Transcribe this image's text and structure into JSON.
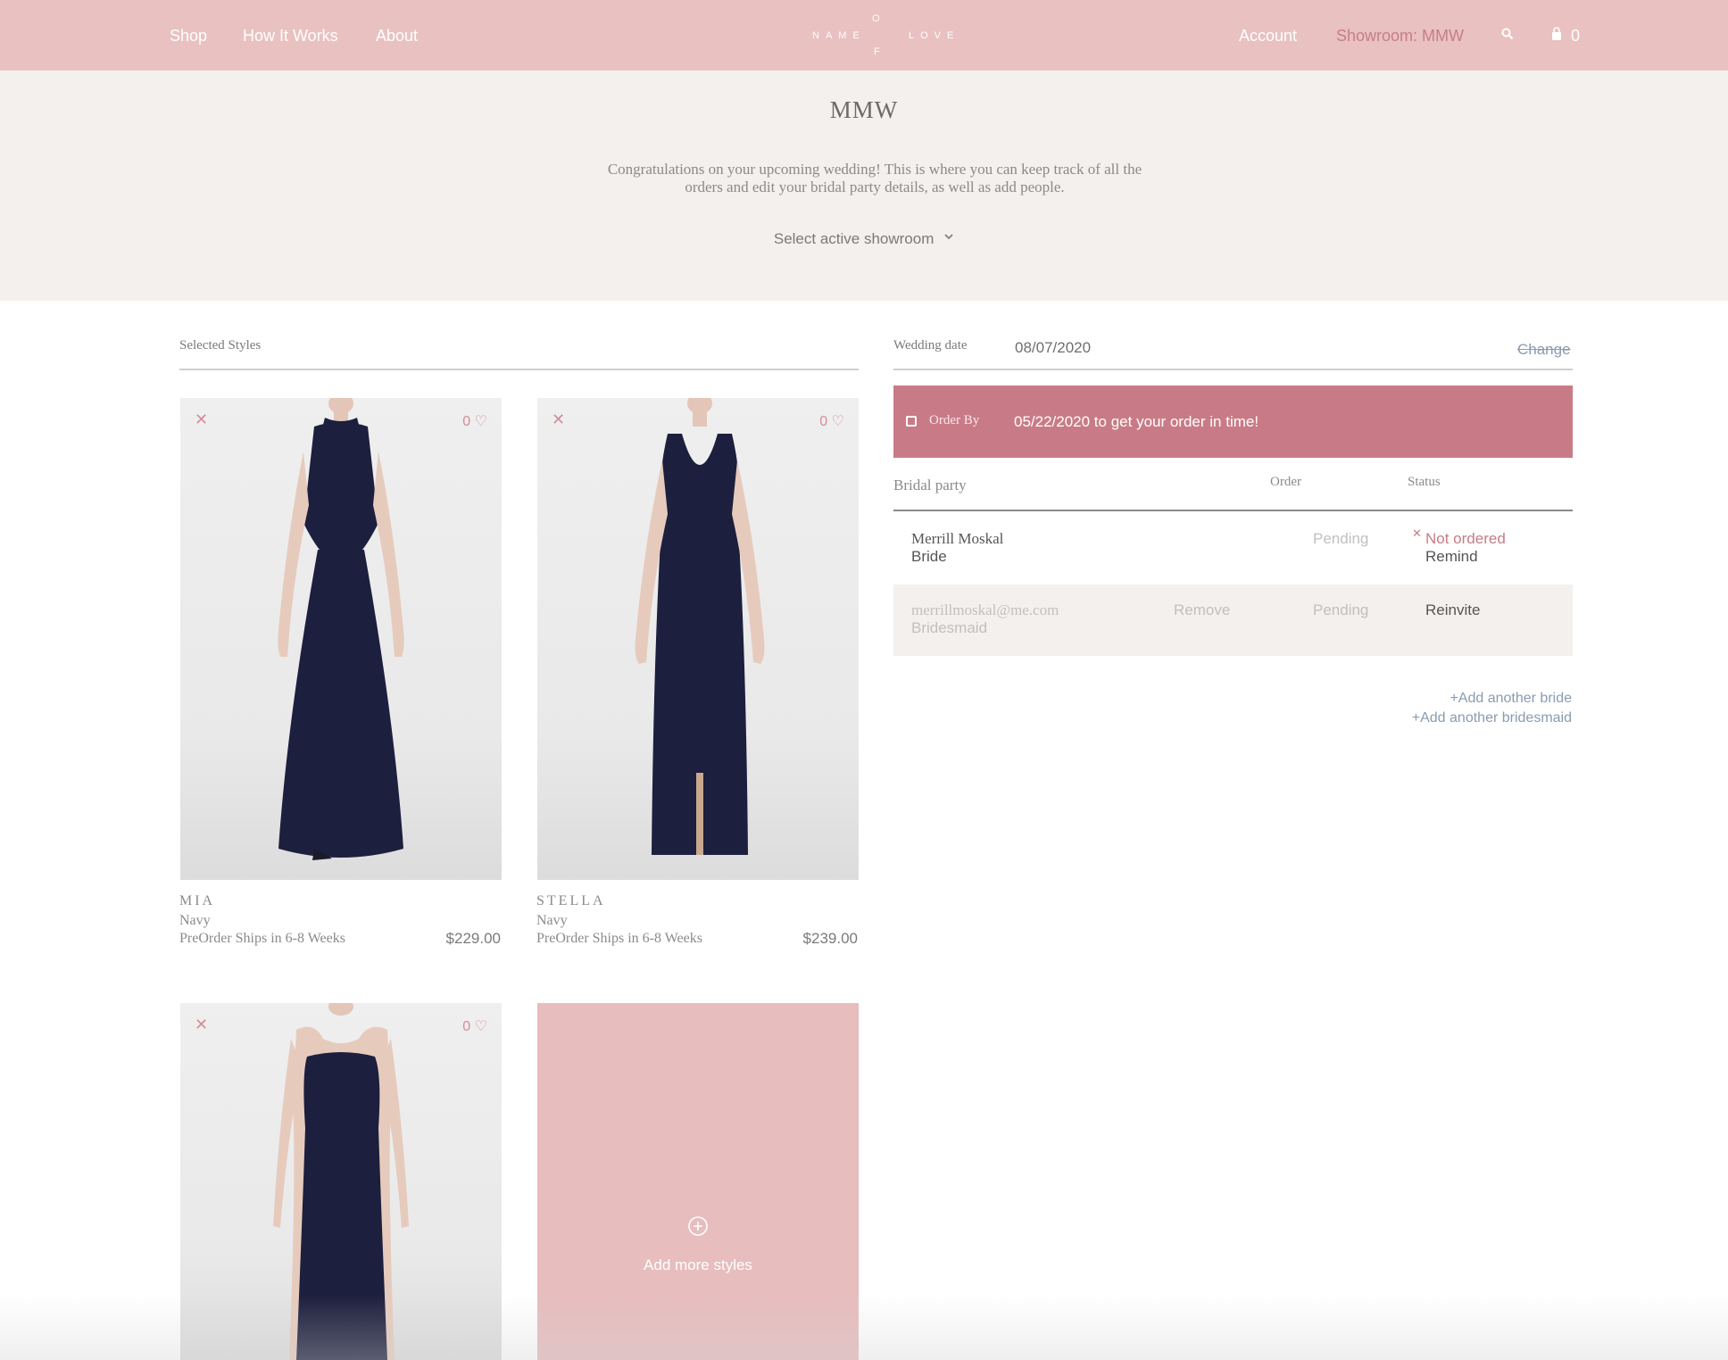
{
  "header": {
    "nav": [
      "Shop",
      "How It Works",
      "About"
    ],
    "logo": {
      "left": "NAME",
      "top": "O",
      "bottom": "F",
      "right": "LOVE"
    },
    "account": "Account",
    "showroom": "Showroom: MMW",
    "search_icon": "search-icon",
    "cart_icon": "bag-icon",
    "cart_count": "0"
  },
  "hero": {
    "title": "MMW",
    "description": "Congratulations on your upcoming wedding! This is where you can keep track of all the orders and edit your bridal party details, as well as add people.",
    "select_label": "Select active showroom",
    "select_icon": "chevron-down-icon"
  },
  "styles": {
    "section_label": "Selected Styles",
    "products": [
      {
        "name": "MIA",
        "color": "Navy",
        "shipping": "PreOrder Ships in 6-8 Weeks",
        "price": "$229.00",
        "likes": "0"
      },
      {
        "name": "STELLA",
        "color": "Navy",
        "shipping": "PreOrder Ships in 6-8 Weeks",
        "price": "$239.00",
        "likes": "0"
      },
      {
        "likes": "0"
      }
    ],
    "add_more": "Add more styles"
  },
  "wedding": {
    "label": "Wedding date",
    "date": "08/07/2020",
    "change": "Change"
  },
  "order_by": {
    "label": "Order By",
    "text": "05/22/2020 to get your order in time!"
  },
  "party": {
    "headers": {
      "name": "Bridal party",
      "order": "Order",
      "status": "Status"
    },
    "rows": [
      {
        "name": "Merrill Moskal",
        "role": "Bride",
        "order": "Pending",
        "status": "Not ordered",
        "action": "Remind"
      },
      {
        "name": "merrillmoskal@me.com",
        "role": "Bridesmaid",
        "remove": "Remove",
        "order": "Pending",
        "action": "Reinvite"
      }
    ],
    "add_bride": "+Add another bride",
    "add_bridesmaid": "+Add another bridesmaid"
  },
  "colors": {
    "header_bg": "#e9c1c1",
    "hero_bg": "#f4f0ed",
    "accent": "#c87b86",
    "link_blue": "#8a9bb0",
    "dress": "#1c1f3d"
  }
}
